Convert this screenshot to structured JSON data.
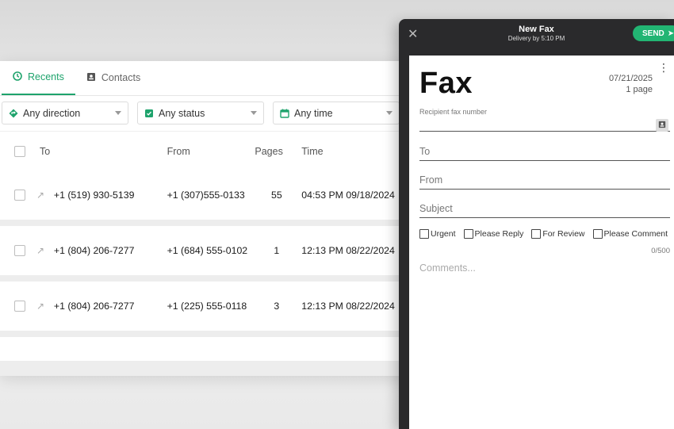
{
  "tabs": [
    {
      "label": "Recents",
      "icon": "clock-icon",
      "active": true
    },
    {
      "label": "Contacts",
      "icon": "contact-card-icon",
      "active": false
    }
  ],
  "filters": [
    {
      "label": "Any direction",
      "icon": "direction-icon"
    },
    {
      "label": "Any status",
      "icon": "status-icon"
    },
    {
      "label": "Any time",
      "icon": "calendar-icon"
    }
  ],
  "table": {
    "headers": {
      "to": "To",
      "from": "From",
      "pages": "Pages",
      "time": "Time"
    },
    "rows": [
      {
        "to": "+1 (519) 930-5139",
        "from": "+1 (307)555-0133",
        "pages": "55",
        "time": "04:53 PM 09/18/2024"
      },
      {
        "to": "+1 (804) 206-7277",
        "from": "+1 (684) 555-0102",
        "pages": "1",
        "time": "12:13 PM 08/22/2024"
      },
      {
        "to": "+1 (804) 206-7277",
        "from": "+1 (225) 555-0118",
        "pages": "3",
        "time": "12:13 PM 08/22/2024"
      }
    ]
  },
  "panel": {
    "title": "New Fax",
    "subtitle": "Delivery by 5:10 PM",
    "send_label": "SEND",
    "fax_heading": "Fax",
    "date": "07/21/2025",
    "page_count": "1 page",
    "recipient_label": "Recipient fax number",
    "to_label": "To",
    "from_label": "From",
    "subject_label": "Subject",
    "checkboxes": [
      "Urgent",
      "Please Reply",
      "For Review",
      "Please Comment"
    ],
    "counter": "0/500",
    "comments_placeholder": "Comments..."
  },
  "colors": {
    "accent": "#1ea36c",
    "send": "#22b573",
    "panel_bg": "#2a2a2c"
  }
}
